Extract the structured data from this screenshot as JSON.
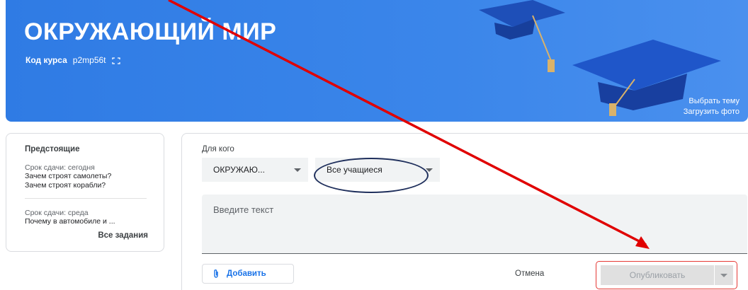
{
  "banner": {
    "title": "ОКРУЖАЮЩИЙ МИР",
    "course_code_label": "Код курса",
    "course_code_value": "p2mp56t",
    "select_theme": "Выбрать тему",
    "upload_photo": "Загрузить фото",
    "background_color": "#3b86ea"
  },
  "upcoming": {
    "title": "Предстоящие",
    "groups": [
      {
        "due": "Срок сдачи: сегодня",
        "tasks": [
          "Зачем строят самолеты?",
          "Зачем строят корабли?"
        ]
      },
      {
        "due": "Срок сдачи: среда",
        "tasks": [
          "Почему в автомобиле и ..."
        ]
      }
    ],
    "all_tasks": "Все задания"
  },
  "composer": {
    "for_whom_label": "Для кого",
    "course_select": "ОКРУЖАЮ...",
    "students_select": "Все учащиеся",
    "text_placeholder": "Введите текст",
    "add_button": "Добавить",
    "cancel_button": "Отмена",
    "publish_button": "Опубликовать"
  },
  "annotations": {
    "arrow_color": "#e00000",
    "ellipse_color": "#1f2f5c"
  }
}
